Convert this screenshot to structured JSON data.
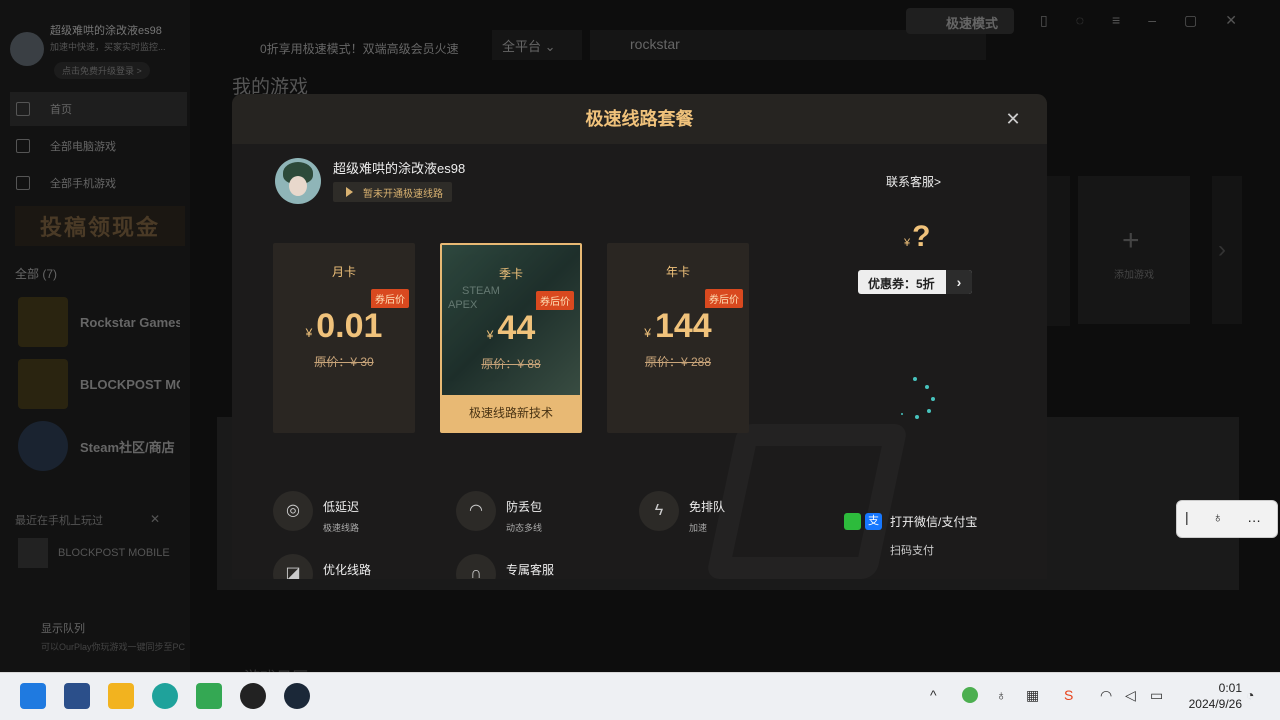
{
  "sidebar": {
    "user_name": "超级难哄的涂改液es98",
    "user_sub": "加速中快速，买家实时监控...",
    "vip_label": "点击免费升级登录 >",
    "nav": [
      "首页",
      "全部电脑游戏",
      "全部手机游戏"
    ],
    "banner": "投稿领现金",
    "all_label": "全部 (7)",
    "games": [
      "Rockstar Games",
      "BLOCKPOST MOBILE",
      "Steam社区/商店"
    ],
    "recent_label": "最近在手机上玩过",
    "recent_game": "BLOCKPOST MOBILE",
    "queue_title": "显示队列",
    "queue_sub": "可以OurPlay你玩游戏一键同步至PC"
  },
  "topbar": {
    "notice": "0折享用极速模式！双端高级会员火速",
    "platform": "全平台",
    "search_value": "rockstar",
    "speed_mode": "极速模式"
  },
  "main": {
    "my_games": "我的游戏",
    "add_game": "添加游戏",
    "bottom_label": "游戏日历"
  },
  "modal": {
    "title": "极速线路套餐",
    "user_name": "超级难哄的涂改液es98",
    "user_status": "暂未开通极速线路",
    "service_link": "联系客服>",
    "coupon_label": "优惠券：5折",
    "plans": [
      {
        "name": "月卡",
        "badge": "券后价",
        "currency": "¥",
        "price": "0.01",
        "original": "原价：¥ 30"
      },
      {
        "name": "季卡",
        "badge": "券后价",
        "currency": "¥",
        "price": "44",
        "original": "原价：¥ 88",
        "footer": "极速线路新技术",
        "art_text": [
          "APEX",
          "STEAM"
        ]
      },
      {
        "name": "年卡",
        "badge": "券后价",
        "currency": "¥",
        "price": "144",
        "original": "原价：¥ 288"
      }
    ],
    "selected_plan": "季卡",
    "features": [
      {
        "title": "低延迟",
        "sub": "极速线路"
      },
      {
        "title": "防丢包",
        "sub": "动态多线"
      },
      {
        "title": "免排队",
        "sub": "加速"
      },
      {
        "title": "优化线路",
        "sub": ""
      },
      {
        "title": "专属客服",
        "sub": ""
      }
    ],
    "pay_label": "打开微信/支付宝",
    "pay_sub": "扫码支付",
    "alipay_glyph": "支"
  },
  "taskbar": {
    "time": "0:01",
    "date": "2024/9/26"
  }
}
